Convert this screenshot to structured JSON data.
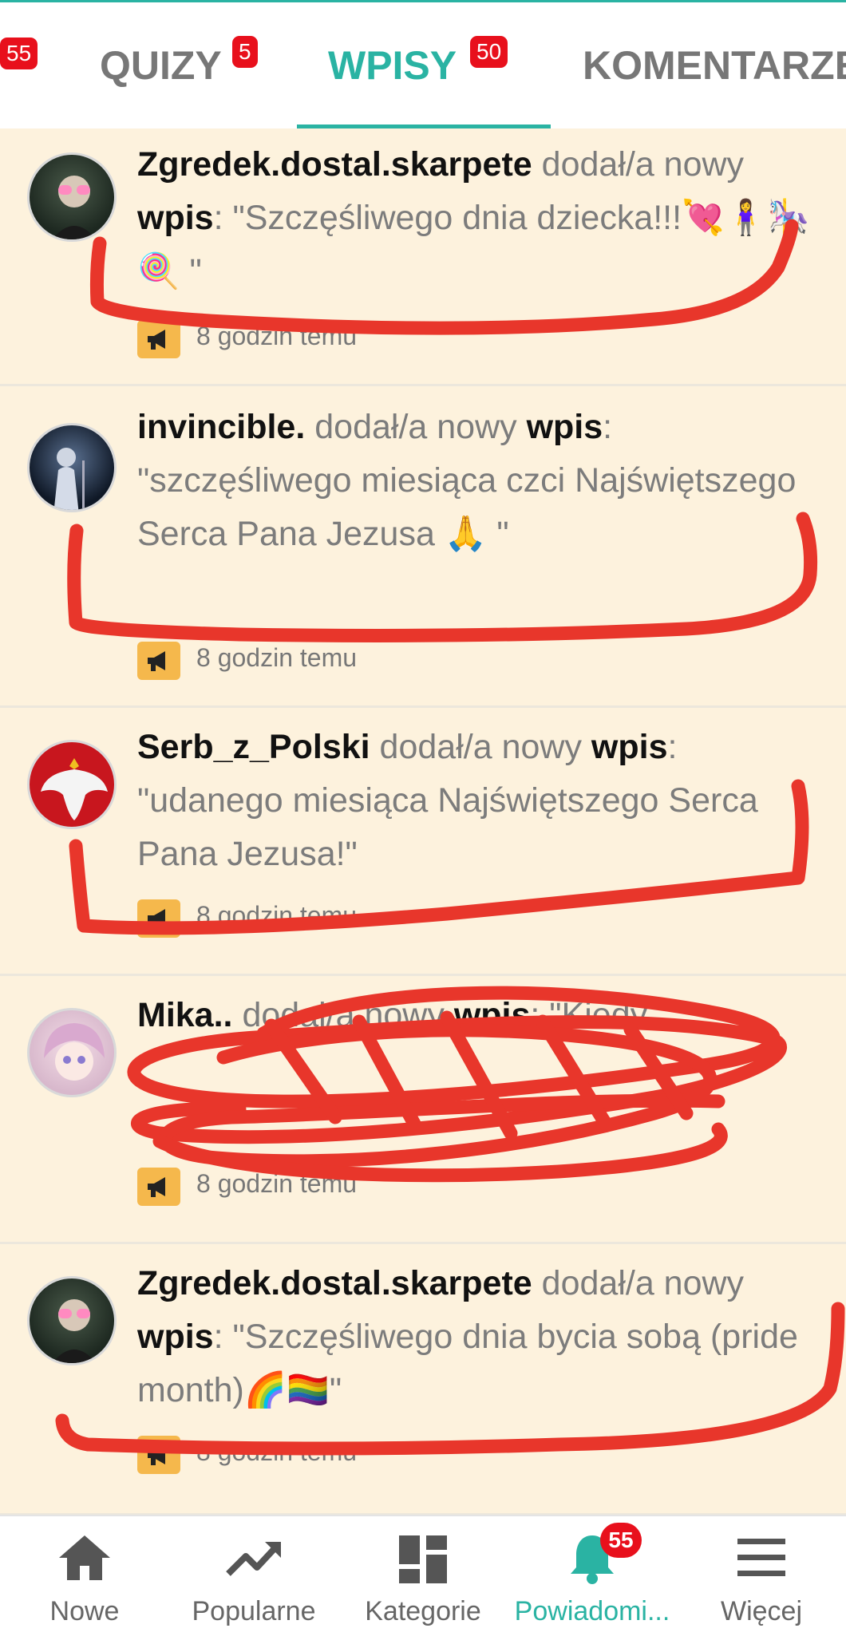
{
  "tabs": [
    {
      "label": "",
      "badge": "55"
    },
    {
      "label": "QUIZY",
      "badge": "5"
    },
    {
      "label": "WPISY",
      "badge": "50",
      "active": true
    },
    {
      "label": "KOMENTARZE",
      "badge": ""
    }
  ],
  "feed": [
    {
      "user": "Zgredek.dostal.skarpete",
      "action": "dodał/a nowy",
      "keyword": "wpis",
      "content": "\"Szczęśliwego dnia dziecka!!!💘🧍‍♀️🎠🍭 \"",
      "time": "8 godzin temu"
    },
    {
      "user": "invincible.",
      "action": "dodał/a nowy",
      "keyword": "wpis",
      "content": "\"szczęśliwego miesiąca czci Najświętszego Serca Pana Jezusa 🙏 \"",
      "time": "8 godzin temu"
    },
    {
      "user": "Serb_z_Polski",
      "action": "dodał/a nowy",
      "keyword": "wpis",
      "content": "\"udanego miesiąca Najświętszego Serca Pana Jezusa!\"",
      "time": "8 godzin temu"
    },
    {
      "user": "Mika..",
      "action": "dodał/a nowy",
      "keyword": "wpis",
      "content": "\"Kiedy ...\"",
      "time": "8 godzin temu"
    },
    {
      "user": "Zgredek.dostal.skarpete",
      "action": "dodał/a nowy",
      "keyword": "wpis",
      "content": "\"Szczęśliwego dnia bycia sobą (pride month)🌈🏳️‍🌈\"",
      "time": "8 godzin temu"
    }
  ],
  "bottom_nav": [
    {
      "label": "Nowe",
      "icon": "home-icon"
    },
    {
      "label": "Popularne",
      "icon": "trending-icon"
    },
    {
      "label": "Kategorie",
      "icon": "categories-icon"
    },
    {
      "label": "Powiadomi...",
      "icon": "bell-icon",
      "badge": "55",
      "active": true
    },
    {
      "label": "Więcej",
      "icon": "menu-icon"
    }
  ],
  "colors": {
    "accent": "#2ab3a3",
    "badge": "#e8101c",
    "feed_bg": "#fdf2dd",
    "scribble": "#e8362b"
  }
}
